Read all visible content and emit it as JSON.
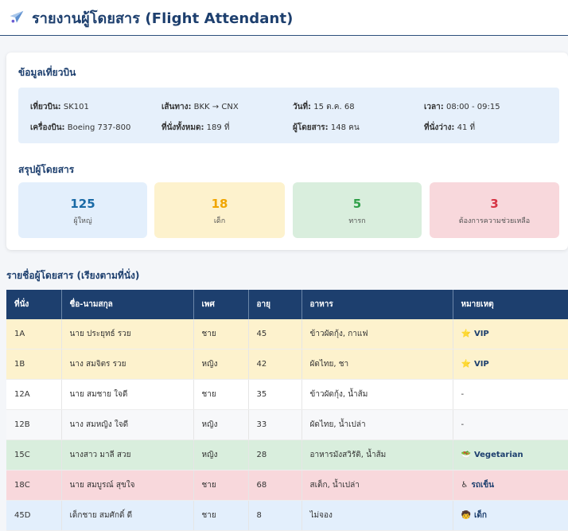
{
  "header": {
    "title": "รายงานผู้โดยสาร (Flight Attendant)",
    "icon": "airplane-icon"
  },
  "flight_info": {
    "section_title": "ข้อมูลเที่ยวบิน",
    "flight_label": "เที่ยวบิน:",
    "flight_value": "SK101",
    "route_label": "เส้นทาง:",
    "route_value": "BKK → CNX",
    "date_label": "วันที่:",
    "date_value": "15 ต.ค. 68",
    "time_label": "เวลา:",
    "time_value": "08:00 - 09:15",
    "aircraft_label": "เครื่องบิน:",
    "aircraft_value": "Boeing 737-800",
    "seats_label": "ที่นั่งทั้งหมด:",
    "seats_value": "189 ที่",
    "passengers_label": "ผู้โดยสาร:",
    "passengers_value": "148 คน",
    "vacant_label": "ที่นั่งว่าง:",
    "vacant_value": "41 ที่"
  },
  "summary": {
    "section_title": "สรุปผู้โดยสาร",
    "stats": [
      {
        "value": "125",
        "label": "ผู้ใหญ่",
        "color": "#1a6aa6",
        "bg": "#e3effc"
      },
      {
        "value": "18",
        "label": "เด็ก",
        "color": "#f0a500",
        "bg": "#fdf2cd"
      },
      {
        "value": "5",
        "label": "ทารก",
        "color": "#2e9f48",
        "bg": "#d9eedd"
      },
      {
        "value": "3",
        "label": "ต้องการความช่วยเหลือ",
        "color": "#d63343",
        "bg": "#f8d8dc"
      }
    ]
  },
  "passenger_list": {
    "title": "รายชื่อผู้โดยสาร (เรียงตามที่นั่ง)",
    "columns": [
      "ที่นั่ง",
      "ชื่อ-นามสกุล",
      "เพศ",
      "อายุ",
      "อาหาร",
      "หมายเหตุ"
    ],
    "rows": [
      {
        "seat": "1A",
        "name": "นาย ประยุทธ์ รวย",
        "gender": "ชาย",
        "age": "45",
        "meal": "ข้าวผัดกุ้ง, กาแฟ",
        "note": "VIP",
        "note_icon": "star-icon",
        "bg": "#fdf2cd"
      },
      {
        "seat": "1B",
        "name": "นาง สมจิตร รวย",
        "gender": "หญิง",
        "age": "42",
        "meal": "ผัดไทย, ชา",
        "note": "VIP",
        "note_icon": "star-icon",
        "bg": "#fdf2cd"
      },
      {
        "seat": "12A",
        "name": "นาย สมชาย ใจดี",
        "gender": "ชาย",
        "age": "35",
        "meal": "ข้าวผัดกุ้ง, น้ำส้ม",
        "note": "-",
        "note_icon": "",
        "bg": "#ffffff"
      },
      {
        "seat": "12B",
        "name": "นาง สมหญิง ใจดี",
        "gender": "หญิง",
        "age": "33",
        "meal": "ผัดไทย, น้ำเปล่า",
        "note": "-",
        "note_icon": "",
        "bg": "#f7f8fa"
      },
      {
        "seat": "15C",
        "name": "นางสาว มาลี สวย",
        "gender": "หญิง",
        "age": "28",
        "meal": "อาหารมังสวิรัติ, น้ำส้ม",
        "note": "Vegetarian",
        "note_icon": "salad-icon",
        "bg": "#d9eedd"
      },
      {
        "seat": "18C",
        "name": "นาย สมบูรณ์ สุขใจ",
        "gender": "ชาย",
        "age": "68",
        "meal": "สเต็ก, น้ำเปล่า",
        "note": "รถเข็น",
        "note_icon": "wheelchair-icon",
        "bg": "#f8d8dc"
      },
      {
        "seat": "45D",
        "name": "เด็กชาย สมศักดิ์ ดี",
        "gender": "ชาย",
        "age": "8",
        "meal": "ไม่จอง",
        "note": "เด็ก",
        "note_icon": "child-icon",
        "bg": "#e3effc"
      }
    ]
  }
}
